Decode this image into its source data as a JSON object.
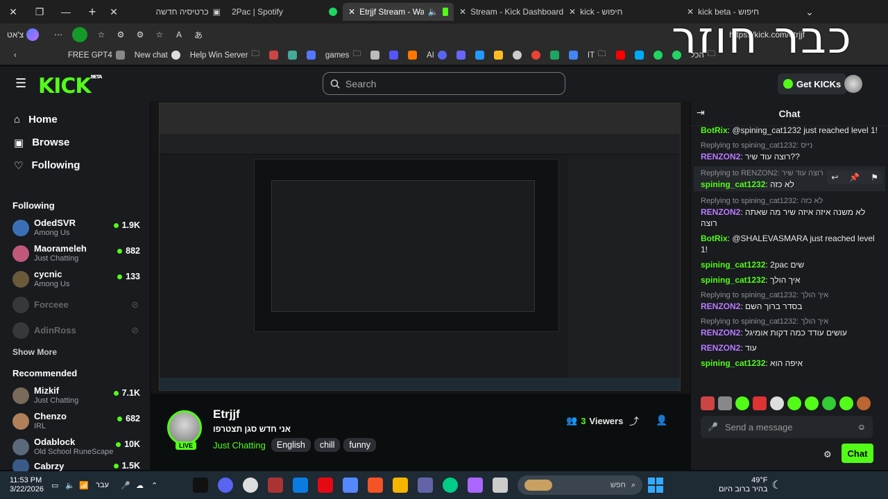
{
  "browser": {
    "tabs": [
      {
        "label": "כרטיסיה חדשה"
      },
      {
        "label": "2Pac | Spotify"
      },
      {
        "label": "Etrjjf Stream - Watch Live"
      },
      {
        "label": "Stream - Kick Dashboard"
      },
      {
        "label": "kick - חיפוש"
      },
      {
        "label": "kick beta - חיפוש"
      }
    ],
    "profile": "צ'אט",
    "url": "https://kick.com/etrjjf",
    "bookmarks": [
      "FREE GPT4",
      "New chat",
      "Help Win Server",
      "games",
      "AI",
      "IT",
      "הכל"
    ]
  },
  "overlay_text": "כבר חוזר",
  "site": {
    "logo": "KICK",
    "logo_badge": "BETA",
    "search_placeholder": "Search",
    "get_kicks": "Get KICKs",
    "nav": [
      {
        "label": "Home",
        "icon": "home-icon"
      },
      {
        "label": "Browse",
        "icon": "browse-icon"
      },
      {
        "label": "Following",
        "icon": "heart-icon"
      }
    ],
    "following_title": "Following",
    "following": [
      {
        "name": "OdedSVR",
        "category": "Among Us",
        "viewers": "1.9K",
        "color": "#3b6fb5"
      },
      {
        "name": "Maorameleh",
        "category": "Just Chatting",
        "viewers": "882",
        "color": "#c0587a"
      },
      {
        "name": "cycnic",
        "category": "Among Us",
        "viewers": "133",
        "color": "#6a5a3a"
      },
      {
        "name": "Forceee",
        "category": "",
        "viewers": "",
        "color": "#555"
      },
      {
        "name": "AdinRoss",
        "category": "",
        "viewers": "",
        "color": "#555"
      }
    ],
    "show_more": "Show More",
    "recommended_title": "Recommended",
    "recommended": [
      {
        "name": "Mizkif",
        "category": "Just Chatting",
        "viewers": "7.1K",
        "color": "#7a6a5a"
      },
      {
        "name": "Chenzo",
        "category": "IRL",
        "viewers": "682",
        "color": "#b0805a"
      },
      {
        "name": "Odablock",
        "category": "Old School RuneScape",
        "viewers": "10K",
        "color": "#5a6a7a"
      },
      {
        "name": "Cabrzy",
        "category": "",
        "viewers": "1.5K",
        "color": "#3a5a8a"
      }
    ]
  },
  "stream": {
    "streamer": "Etrjjf",
    "title": "אני חדש סגן תצטרפו",
    "live": "LIVE",
    "category": "Just Chatting",
    "tags": [
      "English",
      "chill",
      "funny"
    ],
    "viewers": "3",
    "viewers_label": "Viewers"
  },
  "chat": {
    "title": "Chat",
    "messages": [
      {
        "user": "BotRix",
        "text": "@spining_cat1232 just reached level 1!",
        "reply": "",
        "color": "#53fc18"
      },
      {
        "user": "RENZON2",
        "text": "רוצה עוד שיר??",
        "reply": "Replying to spining_cat1232: נייס",
        "color": "#b97bff"
      },
      {
        "user": "spining_cat1232",
        "text": "לא כזה",
        "reply": "Replying to RENZON2: רוצה עוד שיר",
        "color": "#53fc18"
      },
      {
        "user": "RENZON2",
        "text": "לא משנה איזה איזה שיר מה שאתה רוצה",
        "reply": "Replying to spining_cat1232: לא כזה",
        "color": "#b97bff"
      },
      {
        "user": "BotRix",
        "text": "@SHALEVASMARA just reached level 1!",
        "reply": "",
        "color": "#53fc18"
      },
      {
        "user": "spining_cat1232",
        "text": "2pac שים",
        "reply": "",
        "color": "#53fc18"
      },
      {
        "user": "spining_cat1232",
        "text": "איך הולך",
        "reply": "",
        "color": "#53fc18"
      },
      {
        "user": "RENZON2",
        "text": "בסדר ברוך השם",
        "reply": "Replying to spining_cat1232: איך הולך",
        "color": "#b97bff"
      },
      {
        "user": "RENZON2",
        "text": "עושים עודד כמה דקות אומיגל",
        "reply": "Replying to spining_cat1232: איך הולך",
        "color": "#b97bff"
      },
      {
        "user": "RENZON2",
        "text": "עוד",
        "reply": "",
        "color": "#b97bff"
      },
      {
        "user": "spining_cat1232",
        "text": "איפה הוא",
        "reply": "",
        "color": "#53fc18"
      }
    ],
    "input_placeholder": "Send a message",
    "send_label": "Chat"
  },
  "taskbar": {
    "time": "11:53 PM",
    "date": "3/22/2026",
    "lang": "עבר",
    "search_placeholder": "חפש",
    "weather_temp": "49°F",
    "weather_text": "בהיר ברוב היום"
  }
}
